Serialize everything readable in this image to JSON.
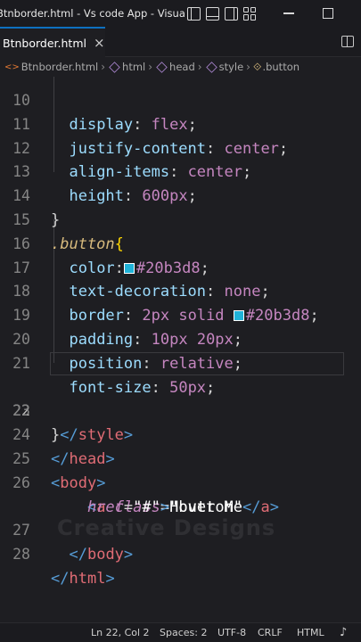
{
  "window": {
    "title": "Btnborder.html - Vs code App - Visual S..."
  },
  "tab": {
    "label": "Btnborder.html",
    "close": "×"
  },
  "breadcrumb": {
    "file": "Btnborder.html",
    "items": [
      "html",
      "head",
      "style",
      ".button"
    ]
  },
  "editor": {
    "lines": [
      {
        "n": "10"
      },
      {
        "n": "11"
      },
      {
        "n": "12"
      },
      {
        "n": "13"
      },
      {
        "n": "14"
      },
      {
        "n": "15"
      },
      {
        "n": "16"
      },
      {
        "n": "17"
      },
      {
        "n": "18"
      },
      {
        "n": "19"
      },
      {
        "n": "20"
      },
      {
        "n": "21"
      },
      {
        "n": "22"
      },
      {
        "n": "23"
      },
      {
        "n": "24"
      },
      {
        "n": "25"
      },
      {
        "n": "26"
      },
      {
        "n": "27"
      },
      {
        "n": "28"
      }
    ],
    "line10": {
      "prop": "display",
      "val": "flex"
    },
    "line11": {
      "prop": "justify-content",
      "val": "center"
    },
    "line12": {
      "prop": "align-items",
      "val": "center"
    },
    "line13": {
      "prop": "height",
      "val": "600px"
    },
    "line14": "}",
    "line15": {
      "selector": ".button",
      "brace": "{"
    },
    "line16": {
      "prop": "color",
      "val": "#20b3d8"
    },
    "line17": {
      "prop": "text-decoration",
      "val": "none"
    },
    "line18": {
      "prop": "border",
      "val1": "2px",
      "val2": "solid",
      "val3": "#20b3d8"
    },
    "line19": {
      "prop": "padding",
      "val1": "10px",
      "val2": "20px"
    },
    "line20": {
      "prop": "position",
      "val": "relative"
    },
    "line21": {
      "prop": "font-size",
      "val": "50px"
    },
    "line22": "}",
    "line23": {
      "tag": "style"
    },
    "line24": {
      "tag": "head"
    },
    "line25": {
      "tag": "body"
    },
    "line26": {
      "tag": "a",
      "attr": "class",
      "str": "\"button\""
    },
    "line26b": {
      "attr": "href",
      "str": "\"#\"",
      "text": "Hover Me",
      "tag": "a"
    },
    "line27": {
      "tag": "body"
    },
    "line28": {
      "tag": "html"
    },
    "swatch_color": "#20b3d8",
    "watermark": "Creative Designs"
  },
  "statusbar": {
    "position": "Ln 22, Col 2",
    "spaces": "Spaces: 2",
    "encoding": "UTF-8",
    "eol": "CRLF",
    "language": "HTML"
  },
  "colors": {
    "accent": "#0e70c0",
    "background": "#1e1e22"
  }
}
